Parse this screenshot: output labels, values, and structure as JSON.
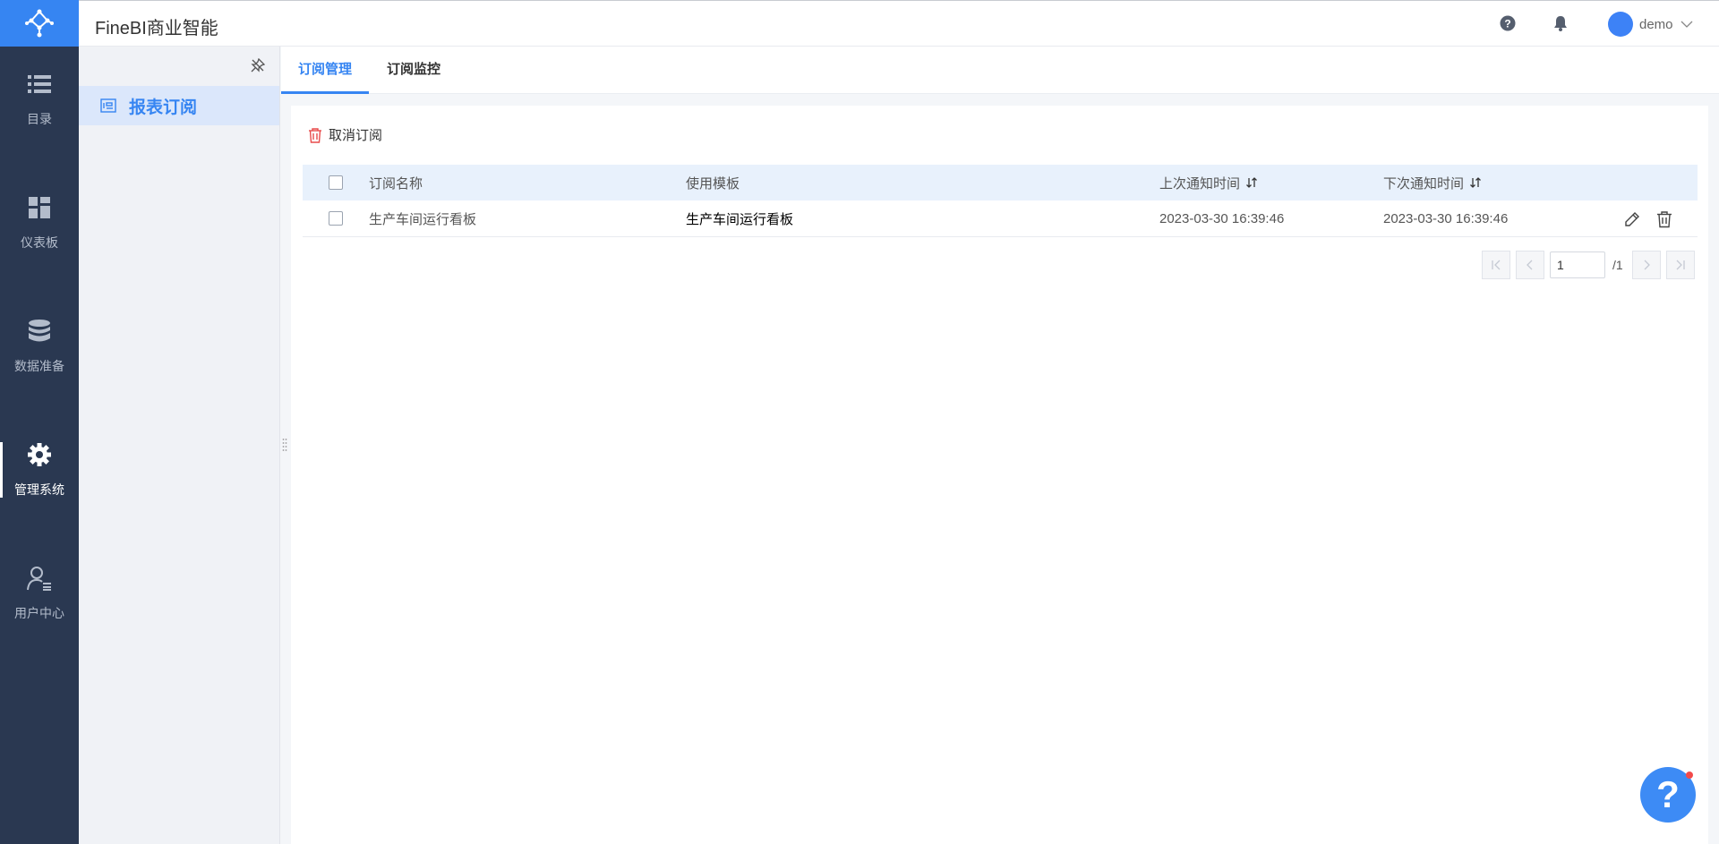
{
  "app": {
    "title": "FineBI商业智能"
  },
  "header": {
    "user_name": "demo",
    "icons": [
      "help-icon",
      "bell-icon",
      "avatar",
      "chevron-down-icon"
    ]
  },
  "leftnav": {
    "items": [
      {
        "label": "目录",
        "icon": "list-icon"
      },
      {
        "label": "仪表板",
        "icon": "dashboard-icon"
      },
      {
        "label": "数据准备",
        "icon": "database-icon"
      },
      {
        "label": "管理系统",
        "icon": "gear-icon",
        "active": true
      },
      {
        "label": "用户中心",
        "icon": "user-icon"
      }
    ]
  },
  "subside": {
    "items": [
      {
        "label": "报表订阅",
        "icon": "report-icon",
        "active": true
      }
    ]
  },
  "tabs": [
    {
      "label": "订阅管理",
      "active": true
    },
    {
      "label": "订阅监控"
    }
  ],
  "toolbar": {
    "cancel_label": "取消订阅"
  },
  "table": {
    "columns": [
      "订阅名称",
      "使用模板",
      "上次通知时间",
      "下次通知时间"
    ],
    "rows": [
      {
        "name": "生产车间运行看板",
        "template": "生产车间运行看板",
        "last": "2023-03-30 16:39:46",
        "next": "2023-03-30 16:39:46"
      }
    ]
  },
  "pager": {
    "current": "1",
    "total": "/1"
  },
  "colors": {
    "accent": "#3685f2",
    "nav_bg": "#2a3851",
    "header_highlight": "#e8f1fc",
    "danger": "#e84b4b"
  }
}
